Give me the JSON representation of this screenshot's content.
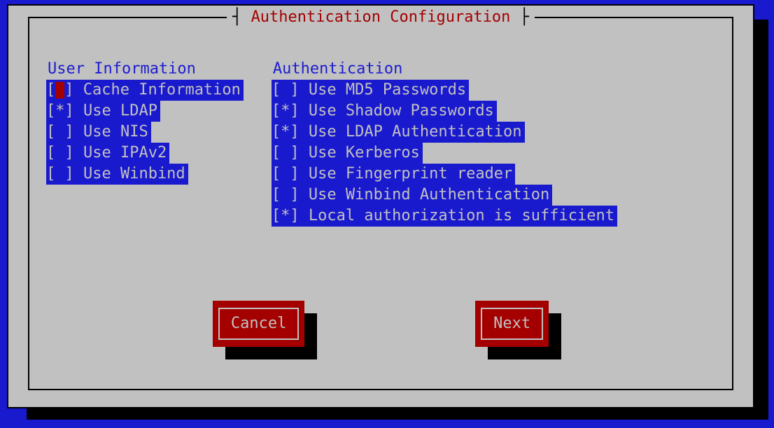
{
  "dialog": {
    "title": "Authentication Configuration"
  },
  "user_info": {
    "heading": "User Information",
    "items": [
      {
        "checked": false,
        "label": "Cache Information",
        "focused": true
      },
      {
        "checked": true,
        "label": "Use LDAP"
      },
      {
        "checked": false,
        "label": "Use NIS"
      },
      {
        "checked": false,
        "label": "Use IPAv2"
      },
      {
        "checked": false,
        "label": "Use Winbind"
      }
    ]
  },
  "authentication": {
    "heading": "Authentication",
    "items": [
      {
        "checked": false,
        "label": "Use MD5 Passwords"
      },
      {
        "checked": true,
        "label": "Use Shadow Passwords"
      },
      {
        "checked": true,
        "label": "Use LDAP Authentication"
      },
      {
        "checked": false,
        "label": "Use Kerberos"
      },
      {
        "checked": false,
        "label": "Use Fingerprint reader"
      },
      {
        "checked": false,
        "label": "Use Winbind Authentication"
      },
      {
        "checked": true,
        "label": "Local authorization is sufficient"
      }
    ]
  },
  "buttons": {
    "cancel": "Cancel",
    "next": "Next"
  }
}
